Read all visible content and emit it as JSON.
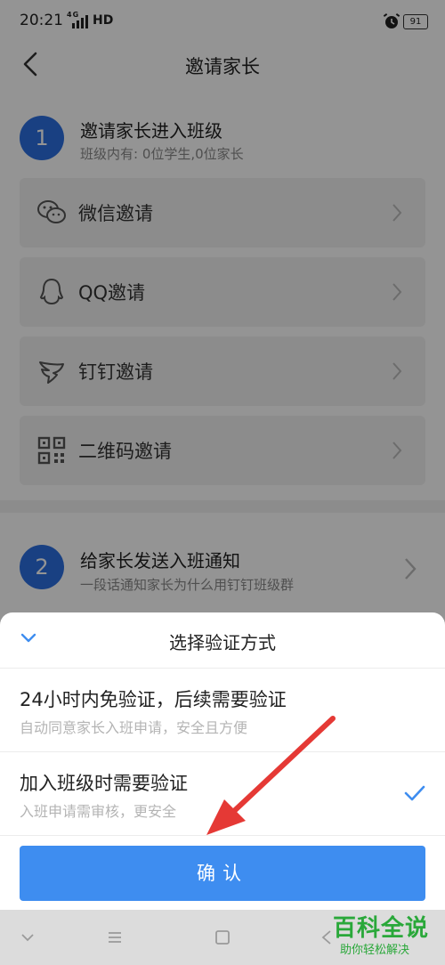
{
  "status_bar": {
    "time": "20:21",
    "network": "4G",
    "hd": "HD",
    "battery": "91"
  },
  "nav": {
    "title": "邀请家长"
  },
  "step1": {
    "number": "1",
    "title": "邀请家长进入班级",
    "subtitle": "班级内有: 0位学生,0位家长"
  },
  "invite_options": [
    {
      "label": "微信邀请",
      "icon": "wechat-icon"
    },
    {
      "label": "QQ邀请",
      "icon": "qq-icon"
    },
    {
      "label": "钉钉邀请",
      "icon": "dingtalk-icon"
    },
    {
      "label": "二维码邀请",
      "icon": "qrcode-icon"
    }
  ],
  "step2": {
    "number": "2",
    "title": "给家长发送入班通知",
    "subtitle": "一段话通知家长为什么用钉钉班级群"
  },
  "sheet": {
    "title": "选择验证方式",
    "options": [
      {
        "title": "24小时内免验证，后续需要验证",
        "subtitle": "自动同意家长入班申请，安全且方便",
        "selected": false
      },
      {
        "title": "加入班级时需要验证",
        "subtitle": "入班申请需审核，更安全",
        "selected": true
      }
    ],
    "confirm_label": "确认"
  },
  "watermark": {
    "main": "百科全说",
    "sub": "助你轻松解决"
  },
  "colors": {
    "accent": "#3e8df0",
    "step_badge": "#2c6fe0",
    "annotation": "#e53935",
    "watermark": "#2aa83a"
  }
}
